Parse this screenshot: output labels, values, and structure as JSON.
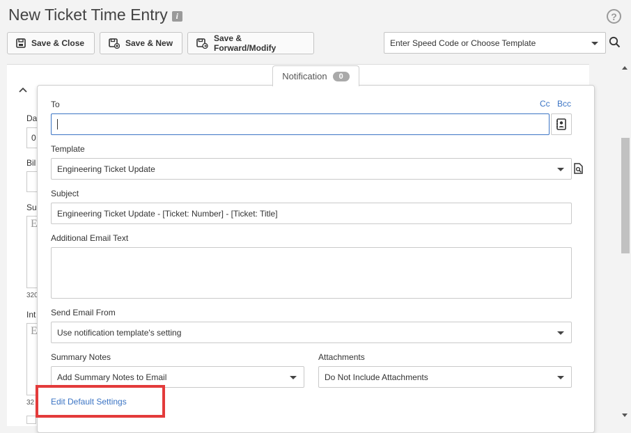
{
  "header": {
    "title": "New Ticket Time Entry"
  },
  "toolbar": {
    "save_close_label": "Save & Close",
    "save_new_label": "Save & New",
    "save_forward_label": "Save & Forward/Modify",
    "speed_code_placeholder": "Enter Speed Code or Choose Template"
  },
  "background_form": {
    "label_date": "Da",
    "value_date": "0",
    "label_billing": "Bil",
    "label_summary": "Su",
    "summary_counter": "320",
    "label_internal": "Int",
    "internal_counter": "32"
  },
  "notification_tab": {
    "label": "Notification",
    "count": "0"
  },
  "notification_form": {
    "to_label": "To",
    "cc_label": "Cc",
    "bcc_label": "Bcc",
    "to_value": "",
    "template_label": "Template",
    "template_value": "Engineering Ticket Update",
    "subject_label": "Subject",
    "subject_value": "Engineering Ticket Update - [Ticket: Number] - [Ticket: Title]",
    "additional_text_label": "Additional Email Text",
    "additional_text_value": "",
    "send_from_label": "Send Email From",
    "send_from_value": "Use notification template's setting",
    "summary_notes_label": "Summary Notes",
    "summary_notes_value": "Add Summary Notes to Email",
    "attachments_label": "Attachments",
    "attachments_value": "Do Not Include Attachments",
    "edit_defaults_label": "Edit Default Settings"
  },
  "colors": {
    "accent": "#3b74c4",
    "highlight": "#e33b3b",
    "badge": "#a9a9a9"
  }
}
